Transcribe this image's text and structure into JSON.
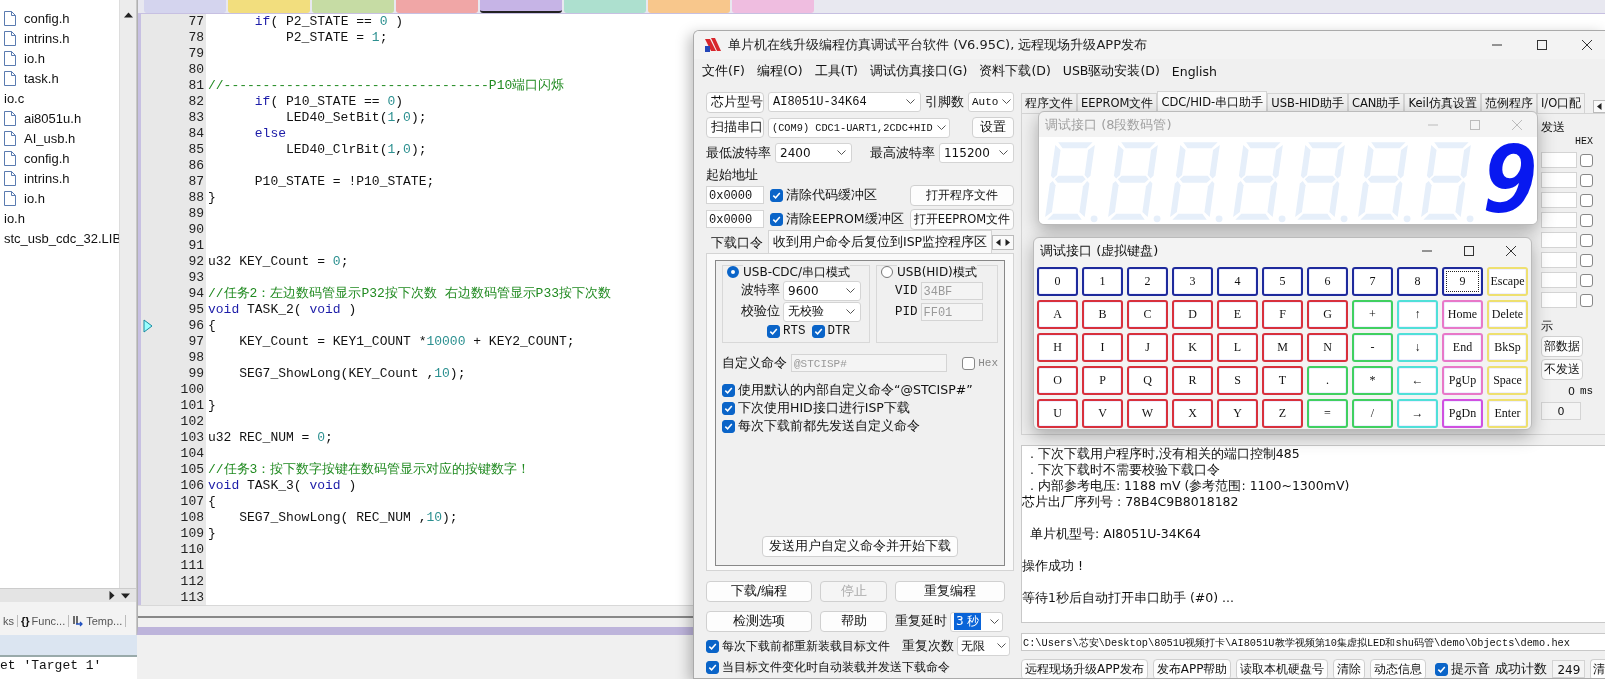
{
  "ide": {
    "project_tree": [
      {
        "label": "config.h",
        "kind": "file"
      },
      {
        "label": "intrins.h",
        "kind": "file"
      },
      {
        "label": "io.h",
        "kind": "file"
      },
      {
        "label": "task.h",
        "kind": "file"
      },
      {
        "label": "io.c",
        "kind": "source",
        "children": [
          {
            "label": "ai8051u.h",
            "kind": "file"
          },
          {
            "label": "AI_usb.h",
            "kind": "file"
          },
          {
            "label": "config.h",
            "kind": "file"
          },
          {
            "label": "intrins.h",
            "kind": "file"
          },
          {
            "label": "io.h",
            "kind": "file"
          }
        ]
      },
      {
        "label": "io.h",
        "kind": "source"
      },
      {
        "label": "stc_usb_cdc_32.LIB",
        "kind": "source"
      }
    ],
    "panel_tabs": [
      {
        "kind": "books",
        "label": "ks"
      },
      {
        "kind": "functions",
        "glyph": "{}",
        "label": "Func..."
      },
      {
        "kind": "templates",
        "label": "Temp..."
      }
    ],
    "editor_tabs": [
      {
        "color": "#d4d4ee",
        "selected": false
      },
      {
        "color": "#f2de7e",
        "selected": false
      },
      {
        "color": "#c6dca4",
        "selected": false
      },
      {
        "color": "#f0a6a6",
        "selected": false
      },
      {
        "color": "#c6b4e6",
        "selected": true
      },
      {
        "color": "#ade0cf",
        "selected": false
      },
      {
        "color": "#f8c78c",
        "selected": false
      },
      {
        "color": "#efbde0",
        "selected": false
      }
    ],
    "code_lines": [
      {
        "number": "77",
        "current": false,
        "tokens": [
          {
            "kind": "keyword",
            "text": "      if"
          },
          {
            "kind": "plain",
            "text": "( P2_STATE == "
          },
          {
            "kind": "number",
            "text": "0"
          },
          {
            "kind": "plain",
            "text": " )"
          }
        ]
      },
      {
        "number": "78",
        "current": false,
        "tokens": [
          {
            "kind": "plain",
            "text": "          P2_STATE = "
          },
          {
            "kind": "number",
            "text": "1"
          },
          {
            "kind": "plain",
            "text": ";"
          }
        ]
      },
      {
        "number": "79",
        "current": false
      },
      {
        "number": "80",
        "current": false
      },
      {
        "number": "81",
        "current": false,
        "tokens": [
          {
            "kind": "comment",
            "text": "//----------------------------------P10端口闪烁"
          }
        ]
      },
      {
        "number": "82",
        "current": false,
        "tokens": [
          {
            "kind": "keyword",
            "text": "      if"
          },
          {
            "kind": "plain",
            "text": "( P10_STATE == "
          },
          {
            "kind": "number",
            "text": "0"
          },
          {
            "kind": "plain",
            "text": ")"
          }
        ]
      },
      {
        "number": "83",
        "current": false,
        "tokens": [
          {
            "kind": "plain",
            "text": "          LED40_SetBit("
          },
          {
            "kind": "number",
            "text": "1"
          },
          {
            "kind": "plain",
            "text": ","
          },
          {
            "kind": "number",
            "text": "0"
          },
          {
            "kind": "plain",
            "text": ");"
          }
        ]
      },
      {
        "number": "84",
        "current": false,
        "tokens": [
          {
            "kind": "keyword",
            "text": "      else"
          }
        ]
      },
      {
        "number": "85",
        "current": false,
        "tokens": [
          {
            "kind": "plain",
            "text": "          LED40_ClrBit("
          },
          {
            "kind": "number",
            "text": "1"
          },
          {
            "kind": "plain",
            "text": ","
          },
          {
            "kind": "number",
            "text": "0"
          },
          {
            "kind": "plain",
            "text": ");"
          }
        ]
      },
      {
        "number": "86",
        "current": false
      },
      {
        "number": "87",
        "current": false,
        "tokens": [
          {
            "kind": "plain",
            "text": "      P10_STATE = !P10_STATE;"
          }
        ]
      },
      {
        "number": "88",
        "current": false,
        "tokens": [
          {
            "kind": "plain",
            "text": "}"
          }
        ]
      },
      {
        "number": "89",
        "current": false
      },
      {
        "number": "90",
        "current": false
      },
      {
        "number": "91",
        "current": false
      },
      {
        "number": "92",
        "current": false,
        "tokens": [
          {
            "kind": "plain",
            "text": "u32 KEY_Count = "
          },
          {
            "kind": "number",
            "text": "0"
          },
          {
            "kind": "plain",
            "text": ";"
          }
        ]
      },
      {
        "number": "93",
        "current": false
      },
      {
        "number": "94",
        "current": false,
        "tokens": [
          {
            "kind": "comment",
            "text": "//任务2：左边数码管显示P32按下次数 右边数码管显示P33按下次数"
          }
        ]
      },
      {
        "number": "95",
        "current": false,
        "tokens": [
          {
            "kind": "keyword",
            "text": "void"
          },
          {
            "kind": "plain",
            "text": " TASK_2( "
          },
          {
            "kind": "keyword",
            "text": "void"
          },
          {
            "kind": "plain",
            "text": " )"
          }
        ]
      },
      {
        "number": "96",
        "current": true,
        "tokens": [
          {
            "kind": "plain",
            "text": "{"
          }
        ]
      },
      {
        "number": "97",
        "current": false,
        "tokens": [
          {
            "kind": "plain",
            "text": "    KEY_Count = KEY1_COUNT *"
          },
          {
            "kind": "number",
            "text": "10000"
          },
          {
            "kind": "plain",
            "text": " + KEY2_COUNT;"
          }
        ]
      },
      {
        "number": "98",
        "current": false
      },
      {
        "number": "99",
        "current": false,
        "tokens": [
          {
            "kind": "plain",
            "text": "    SEG7_ShowLong(KEY_Count ,"
          },
          {
            "kind": "number",
            "text": "10"
          },
          {
            "kind": "plain",
            "text": ");"
          }
        ]
      },
      {
        "number": "100",
        "current": false
      },
      {
        "number": "101",
        "current": false,
        "tokens": [
          {
            "kind": "plain",
            "text": "}"
          }
        ]
      },
      {
        "number": "102",
        "current": false
      },
      {
        "number": "103",
        "current": false,
        "tokens": [
          {
            "kind": "plain",
            "text": "u32 REC_NUM = "
          },
          {
            "kind": "number",
            "text": "0"
          },
          {
            "kind": "plain",
            "text": ";"
          }
        ]
      },
      {
        "number": "104",
        "current": false
      },
      {
        "number": "105",
        "current": false,
        "tokens": [
          {
            "kind": "comment",
            "text": "//任务3：按下数字按键在数码管显示对应的按键数字！"
          }
        ]
      },
      {
        "number": "106",
        "current": false,
        "tokens": [
          {
            "kind": "keyword",
            "text": "void"
          },
          {
            "kind": "plain",
            "text": " TASK_3( "
          },
          {
            "kind": "keyword",
            "text": "void"
          },
          {
            "kind": "plain",
            "text": " )"
          }
        ]
      },
      {
        "number": "107",
        "current": false,
        "tokens": [
          {
            "kind": "plain",
            "text": "{"
          }
        ]
      },
      {
        "number": "108",
        "current": false,
        "tokens": [
          {
            "kind": "plain",
            "text": "    SEG7_ShowLong( REC_NUM ,"
          },
          {
            "kind": "number",
            "text": "10"
          },
          {
            "kind": "plain",
            "text": ");"
          }
        ]
      },
      {
        "number": "109",
        "current": false,
        "tokens": [
          {
            "kind": "plain",
            "text": "}"
          }
        ]
      },
      {
        "number": "110",
        "current": false
      },
      {
        "number": "111",
        "current": false
      },
      {
        "number": "112",
        "current": false
      },
      {
        "number": "113",
        "current": false
      }
    ],
    "output_lines": [
      "et 'Target 1'"
    ]
  },
  "isp": {
    "title": "单片机在线升级编程仿真调试平台软件 (V6.95C), 远程现场升级APP发布",
    "menu": [
      "文件(F)",
      "编程(O)",
      "工具(T)",
      "调试仿真接口(G)",
      "资料下载(D)",
      "USB驱动安装(D)",
      "English"
    ],
    "chip_button": "芯片型号",
    "chip_value": "AI8051U-34K64",
    "pins_label": "引脚数",
    "pins_value": "Auto",
    "scan_button": "扫描串口",
    "port_value": "(COM9) CDC1-UART1,2CDC+HID",
    "settings_button": "设置",
    "min_baud_label": "最低波特率",
    "min_baud_value": "2400",
    "max_baud_label": "最高波特率",
    "max_baud_value": "115200",
    "start_address_label": "起始地址",
    "address_rows": [
      {
        "address": "0x0000",
        "label": "清除代码缓冲区",
        "checked": true,
        "button": "打开程序文件"
      },
      {
        "address": "0x0000",
        "label": "清除EEPROM缓冲区",
        "checked": true,
        "button": "打开EEPROM文件"
      }
    ],
    "tabs": [
      {
        "label": "下载口令",
        "selected": false
      },
      {
        "label": "收到用户命令后复位到ISP监控程序区",
        "selected": true
      }
    ],
    "modes": [
      {
        "label": "USB-CDC/串口模式",
        "selected": true
      },
      {
        "label": "USB(HID)模式",
        "selected": false
      }
    ],
    "baud_label": "波特率",
    "baud_value": "9600",
    "parity_label": "校验位",
    "parity_value": "无校验",
    "line_options": [
      {
        "label": "RTS",
        "checked": true
      },
      {
        "label": "DTR",
        "checked": true
      }
    ],
    "vid_label": "VID",
    "vid_value": "34BF",
    "pid_label": "PID",
    "pid_value": "FF01",
    "custom_command_label": "自定义命令",
    "custom_command_value": "@STCISP#",
    "hex_option": {
      "label": "Hex",
      "checked": false
    },
    "options": [
      {
        "label": "使用默认的内部自定义命令“@STCISP#”",
        "checked": true
      },
      {
        "label": "下次使用HID接口进行ISP下载",
        "checked": true
      },
      {
        "label": "每次下载前都先发送自定义命令",
        "checked": true
      }
    ],
    "send_button": "发送用户自定义命令并开始下载",
    "action_buttons": [
      {
        "label": "下载/编程",
        "disabled": false
      },
      {
        "label": "停止",
        "disabled": true
      },
      {
        "label": "重复编程",
        "disabled": false
      },
      {
        "label": "检测选项",
        "disabled": false
      },
      {
        "label": "帮助",
        "disabled": false
      }
    ],
    "repeat_delay_label": "重复延时",
    "repeat_delay_value": "3 秒",
    "repeat_count_label": "重复次数",
    "repeat_count_value": "无限",
    "reload_options": [
      {
        "label": "每次下载前都重新装载目标文件",
        "checked": true
      },
      {
        "label": "当目标文件变化时自动装载并发送下载命令",
        "checked": true
      }
    ],
    "right_tabs": [
      {
        "label": "程序文件",
        "selected": false
      },
      {
        "label": "EEPROM文件",
        "selected": false
      },
      {
        "label": "CDC/HID-串口助手",
        "selected": true
      },
      {
        "label": "USB-HID助手",
        "selected": false
      },
      {
        "label": "CAN助手",
        "selected": false
      },
      {
        "label": "Keil仿真设置",
        "selected": false
      },
      {
        "label": "范例程序",
        "selected": false
      },
      {
        "label": "I/O口配",
        "selected": false
      }
    ],
    "serial_panel": {
      "group_label": "发送",
      "hex_label": "HEX",
      "hex_rows": [
        {
          "checked": false
        },
        {
          "checked": false
        },
        {
          "checked": false
        },
        {
          "checked": false
        },
        {
          "checked": false
        },
        {
          "checked": false
        },
        {
          "checked": false
        },
        {
          "checked": false
        }
      ],
      "show_label": "示",
      "buttons": [
        "部数据",
        "不发送"
      ],
      "interval_value": "0",
      "interval_unit": "ms",
      "count_value": "0"
    },
    "log_paragraphs": [
      {
        "lines": [
          "  . 下次下载用户程序时,没有相关的端口控制485",
          "  . 下次下载时不需要校验下载口令",
          "  . 内部参考电压: 1188 mV (参考范围: 1100~1300mV)",
          "芯片出厂序列号 : 78B4C9B8018182"
        ]
      },
      {
        "lines": [
          "  单片机型号: AI8051U-34K64"
        ]
      },
      {
        "lines": [
          "操作成功 !"
        ]
      },
      {
        "lines": [
          "等待1秒后自动打开串口助手 (#0) ..."
        ]
      }
    ],
    "file_path": "C:\\Users\\芯安\\Desktop\\8051U视频打卡\\AI8051U教学视频第10集虚拟LED和shu码管\\demo\\Objects\\demo.hex",
    "bottom_buttons": [
      "远程现场升级APP发布",
      "发布APP帮助",
      "读取本机硬盘号",
      "清除",
      "动态信息"
    ],
    "sound_option": {
      "label": "提示音",
      "checked": true
    },
    "success_count_label": "成功计数",
    "success_count_value": "249",
    "clear_button": "清"
  },
  "led_window": {
    "title": "调试接口 (8段数码管)",
    "active": false,
    "digits": [
      {
        "lit": false
      },
      {
        "lit": false
      },
      {
        "lit": false
      },
      {
        "lit": false
      },
      {
        "lit": false
      },
      {
        "lit": false
      },
      {
        "lit": false
      },
      {
        "lit": true,
        "value": "9"
      }
    ]
  },
  "keyboard_window": {
    "title": "调试接口 (虚拟键盘)",
    "active": true,
    "keys": [
      {
        "label": "0",
        "color": "#1e2a9c",
        "focused": false
      },
      {
        "label": "1",
        "color": "#1e2a9c",
        "focused": false
      },
      {
        "label": "2",
        "color": "#1e2a9c",
        "focused": false
      },
      {
        "label": "3",
        "color": "#1e2a9c",
        "focused": false
      },
      {
        "label": "4",
        "color": "#1e2a9c",
        "focused": false
      },
      {
        "label": "5",
        "color": "#1e2a9c",
        "focused": false
      },
      {
        "label": "6",
        "color": "#1e2a9c",
        "focused": false
      },
      {
        "label": "7",
        "color": "#1e2a9c",
        "focused": false
      },
      {
        "label": "8",
        "color": "#1e2a9c",
        "focused": false
      },
      {
        "label": "9",
        "color": "#1e2a9c",
        "focused": true
      },
      {
        "label": "Escape",
        "color": "#eee070",
        "focused": false
      },
      {
        "label": "A",
        "color": "#d8303c",
        "focused": false
      },
      {
        "label": "B",
        "color": "#d8303c",
        "focused": false
      },
      {
        "label": "C",
        "color": "#d8303c",
        "focused": false
      },
      {
        "label": "D",
        "color": "#d8303c",
        "focused": false
      },
      {
        "label": "E",
        "color": "#d8303c",
        "focused": false
      },
      {
        "label": "F",
        "color": "#d8303c",
        "focused": false
      },
      {
        "label": "G",
        "color": "#d8303c",
        "focused": false
      },
      {
        "label": "+",
        "color": "#40d060",
        "focused": false
      },
      {
        "label": "↑",
        "color": "#50e0d8",
        "focused": false
      },
      {
        "label": "Home",
        "color": "#e878c8",
        "focused": false
      },
      {
        "label": "Delete",
        "color": "#eee070",
        "focused": false
      },
      {
        "label": "H",
        "color": "#d8303c",
        "focused": false
      },
      {
        "label": "I",
        "color": "#d8303c",
        "focused": false
      },
      {
        "label": "J",
        "color": "#d8303c",
        "focused": false
      },
      {
        "label": "K",
        "color": "#d8303c",
        "focused": false
      },
      {
        "label": "L",
        "color": "#d8303c",
        "focused": false
      },
      {
        "label": "M",
        "color": "#d8303c",
        "focused": false
      },
      {
        "label": "N",
        "color": "#d8303c",
        "focused": false
      },
      {
        "label": "-",
        "color": "#40d060",
        "focused": false
      },
      {
        "label": "↓",
        "color": "#50e0d8",
        "focused": false
      },
      {
        "label": "End",
        "color": "#e878c8",
        "focused": false
      },
      {
        "label": "BkSp",
        "color": "#eee070",
        "focused": false
      },
      {
        "label": "O",
        "color": "#d8303c",
        "focused": false
      },
      {
        "label": "P",
        "color": "#d8303c",
        "focused": false
      },
      {
        "label": "Q",
        "color": "#d8303c",
        "focused": false
      },
      {
        "label": "R",
        "color": "#d8303c",
        "focused": false
      },
      {
        "label": "S",
        "color": "#d8303c",
        "focused": false
      },
      {
        "label": "T",
        "color": "#d8303c",
        "focused": false
      },
      {
        "label": ".",
        "color": "#40d060",
        "focused": false
      },
      {
        "label": "*",
        "color": "#40d060",
        "focused": false
      },
      {
        "label": "←",
        "color": "#50e0d8",
        "focused": false
      },
      {
        "label": "PgUp",
        "color": "#e878c8",
        "focused": false
      },
      {
        "label": "Space",
        "color": "#eee070",
        "focused": false
      },
      {
        "label": "U",
        "color": "#d8303c",
        "focused": false
      },
      {
        "label": "V",
        "color": "#d8303c",
        "focused": false
      },
      {
        "label": "W",
        "color": "#d8303c",
        "focused": false
      },
      {
        "label": "X",
        "color": "#d8303c",
        "focused": false
      },
      {
        "label": "Y",
        "color": "#d8303c",
        "focused": false
      },
      {
        "label": "Z",
        "color": "#d8303c",
        "focused": false
      },
      {
        "label": "=",
        "color": "#40d060",
        "focused": false
      },
      {
        "label": "/",
        "color": "#40d060",
        "focused": false
      },
      {
        "label": "→",
        "color": "#50e0d8",
        "focused": false
      },
      {
        "label": "PgDn",
        "color": "#d050e0",
        "focused": false
      },
      {
        "label": "Enter",
        "color": "#eee070",
        "focused": false
      }
    ]
  }
}
